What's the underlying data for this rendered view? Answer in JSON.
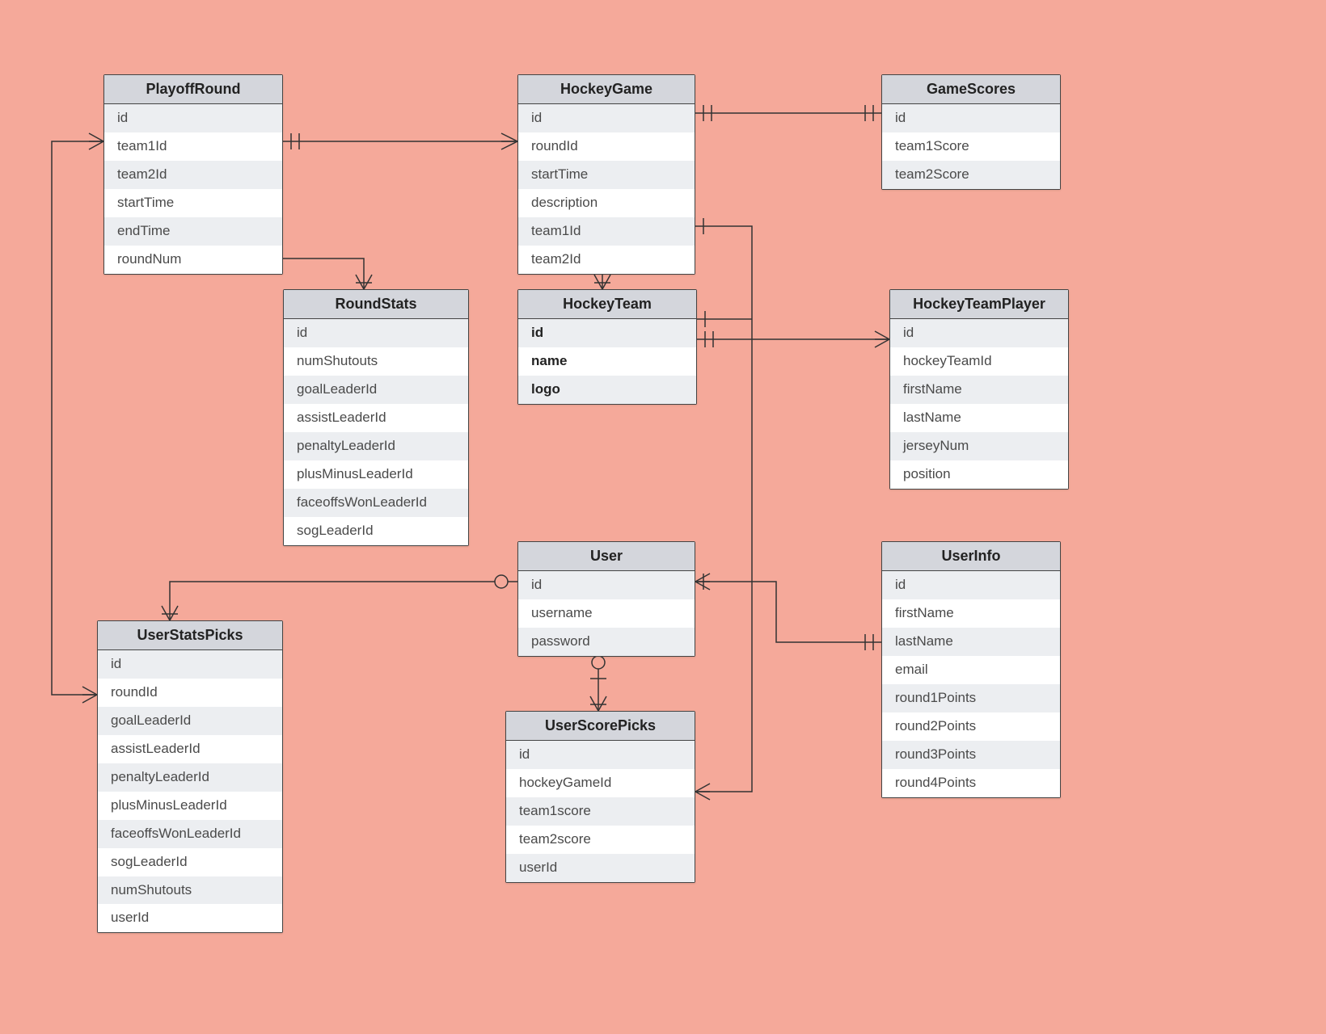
{
  "entities": {
    "playoffRound": {
      "title": "PlayoffRound",
      "fields": [
        "id",
        "team1Id",
        "team2Id",
        "startTime",
        "endTime",
        "roundNum"
      ]
    },
    "hockeyGame": {
      "title": "HockeyGame",
      "fields": [
        "id",
        "roundId",
        "startTime",
        "description",
        "team1Id",
        "team2Id"
      ]
    },
    "gameScores": {
      "title": "GameScores",
      "fields": [
        "id",
        "team1Score",
        "team2Score"
      ]
    },
    "roundStats": {
      "title": "RoundStats",
      "fields": [
        "id",
        "numShutouts",
        "goalLeaderId",
        "assistLeaderId",
        "penaltyLeaderId",
        "plusMinusLeaderId",
        "faceoffsWonLeaderId",
        "sogLeaderId"
      ]
    },
    "hockeyTeam": {
      "title": "HockeyTeam",
      "fields": [
        "id",
        "name",
        "logo"
      ],
      "boldFields": true
    },
    "hockeyTeamPlayer": {
      "title": "HockeyTeamPlayer",
      "fields": [
        "id",
        "hockeyTeamId",
        "firstName",
        "lastName",
        "jerseyNum",
        "position"
      ]
    },
    "user": {
      "title": "User",
      "fields": [
        "id",
        "username",
        "password"
      ]
    },
    "userInfo": {
      "title": "UserInfo",
      "fields": [
        "id",
        "firstName",
        "lastName",
        "email",
        "round1Points",
        "round2Points",
        "round3Points",
        "round4Points"
      ]
    },
    "userStatsPicks": {
      "title": "UserStatsPicks",
      "fields": [
        "id",
        "roundId",
        "goalLeaderId",
        "assistLeaderId",
        "penaltyLeaderId",
        "plusMinusLeaderId",
        "faceoffsWonLeaderId",
        "sogLeaderId",
        "numShutouts",
        "userId"
      ]
    },
    "userScorePicks": {
      "title": "UserScorePicks",
      "fields": [
        "id",
        "hockeyGameId",
        "team1score",
        "team2score",
        "userId"
      ]
    }
  }
}
